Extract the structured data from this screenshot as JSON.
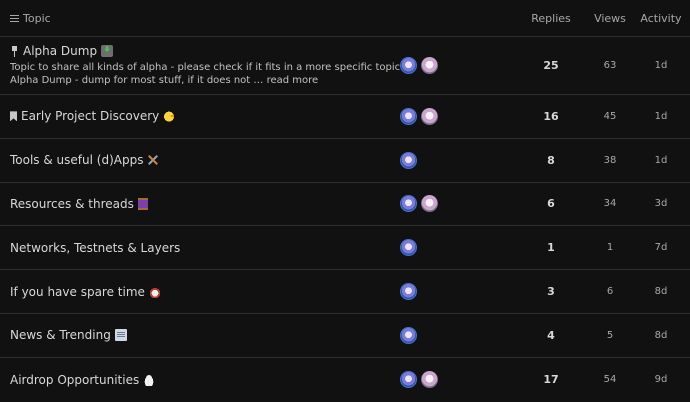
{
  "header": {
    "topic_label": "Topic",
    "replies_label": "Replies",
    "views_label": "Views",
    "activity_label": "Activity"
  },
  "topics": [
    {
      "title": "Alpha Dump",
      "prefix_icon": "pin-icon",
      "emoji": "inbox-tray-emoji",
      "excerpt": "Topic to share all kinds of alpha - please check if it fits in a more specific topic: Alpha Dump - dump for most stuff, if it does not …",
      "read_more": "read more",
      "replies": "25",
      "views": "63",
      "activity": "1d"
    },
    {
      "title": "Early Project Discovery",
      "prefix_icon": "bookmark-icon",
      "emoji": "hatching-chick-emoji",
      "replies": "16",
      "views": "45",
      "activity": "1d"
    },
    {
      "title": "Tools & useful (d)Apps",
      "emoji": "hammer-and-wrench-emoji",
      "replies": "8",
      "views": "38",
      "activity": "1d"
    },
    {
      "title": "Resources & threads",
      "emoji": "thread-spool-emoji",
      "replies": "6",
      "views": "34",
      "activity": "3d"
    },
    {
      "title": "Networks, Testnets & Layers",
      "replies": "1",
      "views": "1",
      "activity": "7d"
    },
    {
      "title": "If you have spare time",
      "emoji": "alarm-clock-emoji",
      "replies": "3",
      "views": "6",
      "activity": "8d"
    },
    {
      "title": "News & Trending",
      "emoji": "newspaper-emoji",
      "replies": "4",
      "views": "5",
      "activity": "8d"
    },
    {
      "title": "Airdrop Opportunities",
      "emoji": "cloud-emoji",
      "replies": "17",
      "views": "54",
      "activity": "9d"
    }
  ]
}
